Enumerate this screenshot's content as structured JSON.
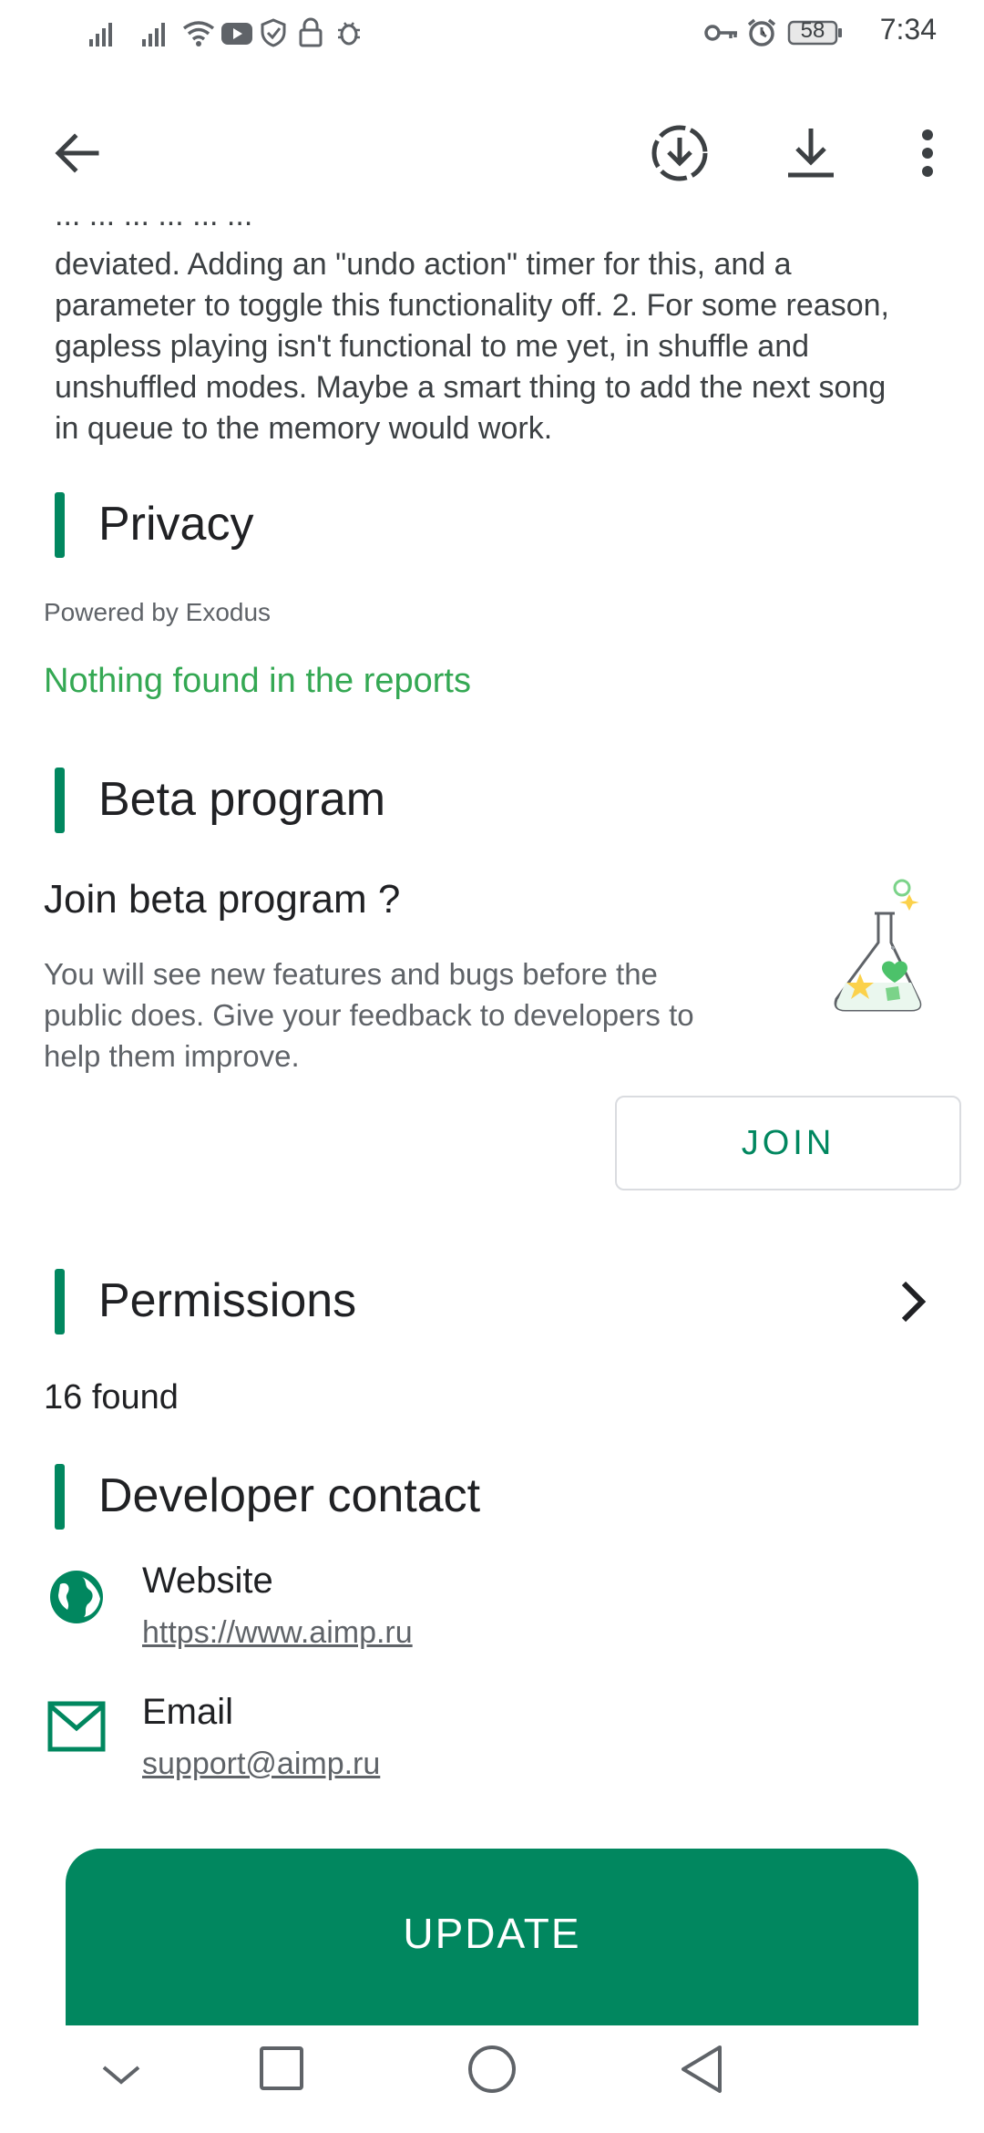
{
  "status_bar": {
    "time": "7:34",
    "battery": "58",
    "icons": [
      "signal-icon",
      "signal-icon",
      "wifi-icon",
      "youtube-icon",
      "shield-icon",
      "lock-icon",
      "bug-icon",
      "key-icon",
      "alarm-icon",
      "battery-icon"
    ]
  },
  "toolbar": {
    "back_icon": "arrow-back-icon",
    "install_icon": "install-download-icon",
    "download_icon": "download-icon",
    "more_icon": "more-vert-icon"
  },
  "review": {
    "line_partial": "... ... ... ... ... ...",
    "lines": [
      "deviated. Adding an \"undo action\" timer for this, and a",
      "parameter to toggle this functionality off. 2. For some reason,",
      "gapless playing isn't functional to me yet, in shuffle and",
      "unshuffled modes. Maybe a smart thing to add the next song",
      "in queue to the memory would work."
    ]
  },
  "privacy": {
    "title": "Privacy",
    "powered_by": "Powered by Exodus",
    "result": "Nothing found in the reports"
  },
  "beta": {
    "title": "Beta program",
    "heading": "Join beta program ?",
    "description_lines": [
      "You will see new features and bugs before the",
      "public does. Give your feedback to developers to",
      "help them improve."
    ],
    "join_label": "JOIN",
    "illustration_icon": "flask-icon"
  },
  "permissions": {
    "title": "Permissions",
    "count": "16 found",
    "chevron_icon": "chevron-right-icon"
  },
  "developer": {
    "title": "Developer contact",
    "website_label": "Website",
    "website_url": "https://www.aimp.ru",
    "email_label": "Email",
    "email_value": "support@aimp.ru"
  },
  "update_label": "UPDATE",
  "colors": {
    "accent": "#01875f",
    "green_text": "#34a853"
  },
  "nav": {
    "icons": [
      "chevron-down-icon",
      "recents-icon",
      "home-icon",
      "back-icon"
    ]
  }
}
